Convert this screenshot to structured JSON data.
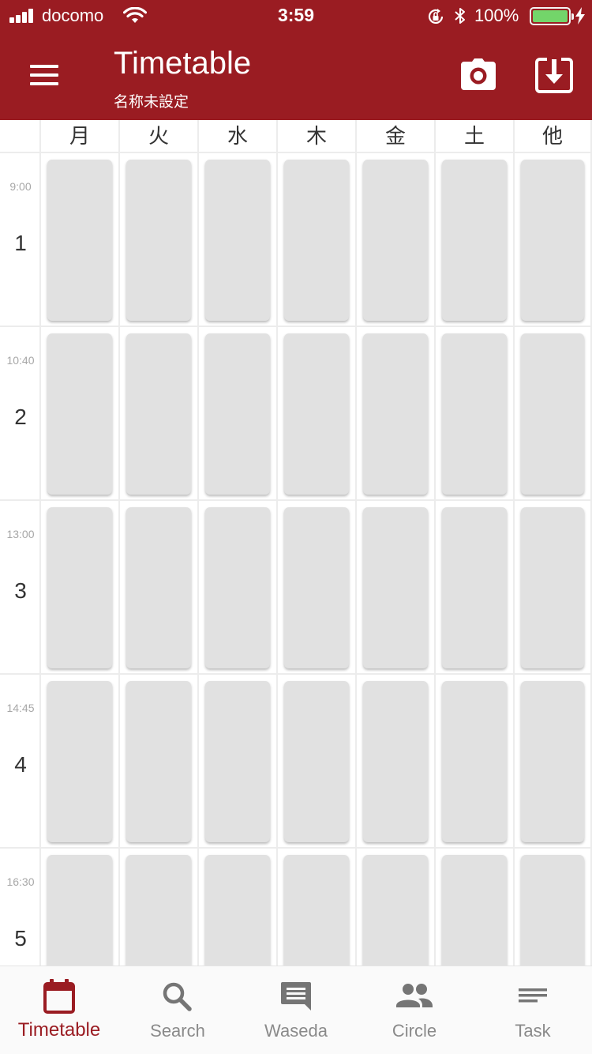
{
  "status_bar": {
    "carrier": "docomo",
    "time": "3:59",
    "battery_percent": "100%",
    "battery_level": 1.0,
    "icons": [
      "signal-icon",
      "wifi-icon",
      "rotation-lock-icon",
      "bluetooth-icon",
      "battery-icon",
      "charging-icon"
    ]
  },
  "app_bar": {
    "title": "Timetable",
    "subtitle": "名称未設定",
    "menu_icon": "hamburger-menu-icon",
    "actions": [
      {
        "name": "camera-icon"
      },
      {
        "name": "download-icon"
      }
    ]
  },
  "timetable": {
    "days": [
      "月",
      "火",
      "水",
      "木",
      "金",
      "土",
      "他"
    ],
    "periods": [
      {
        "number": "1",
        "start": "9:00"
      },
      {
        "number": "2",
        "start": "10:40"
      },
      {
        "number": "3",
        "start": "13:00"
      },
      {
        "number": "4",
        "start": "14:45"
      },
      {
        "number": "5",
        "start": "16:30"
      }
    ]
  },
  "bottom_nav": {
    "items": [
      {
        "label": "Timetable",
        "icon": "calendar-icon",
        "active": true
      },
      {
        "label": "Search",
        "icon": "search-icon",
        "active": false
      },
      {
        "label": "Waseda",
        "icon": "chat-icon",
        "active": false
      },
      {
        "label": "Circle",
        "icon": "people-icon",
        "active": false
      },
      {
        "label": "Task",
        "icon": "notes-icon",
        "active": false
      }
    ]
  },
  "colors": {
    "primary": "#9a1c22",
    "card": "#e1e1e1",
    "inactive": "#8a8a8a",
    "battery": "#73d56a"
  }
}
